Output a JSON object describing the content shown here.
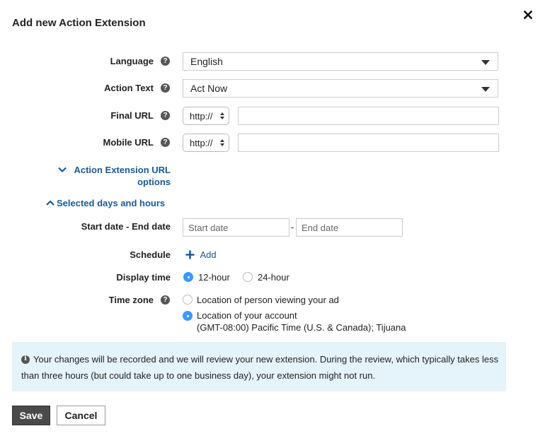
{
  "dialog": {
    "title": "Add new Action Extension",
    "close_icon": "close-icon"
  },
  "form": {
    "language": {
      "label": "Language",
      "value": "English",
      "help_icon": "question-circle-icon"
    },
    "action_text": {
      "label": "Action Text",
      "value": "Act Now",
      "help_icon": "question-circle-icon"
    },
    "final_url": {
      "label": "Final URL",
      "protocol": "http://",
      "value": "",
      "help_icon": "question-circle-icon"
    },
    "mobile_url": {
      "label": "Mobile URL",
      "protocol": "http://",
      "value": "",
      "help_icon": "question-circle-icon"
    },
    "url_options_toggle": {
      "label_line1": "Action Extension URL",
      "label_line2": "options",
      "icon": "chevron-down-icon"
    },
    "days_hours_toggle": {
      "label": "Selected days and hours",
      "icon": "chevron-up-icon"
    },
    "date_range": {
      "label": "Start date - End date",
      "start_placeholder": "Start date",
      "separator": "-",
      "end_placeholder": "End date"
    },
    "schedule": {
      "label": "Schedule",
      "add_label": "Add",
      "icon": "plus-icon"
    },
    "display_time": {
      "label": "Display time",
      "options": [
        {
          "label": "12-hour",
          "selected": true
        },
        {
          "label": "24-hour",
          "selected": false
        }
      ]
    },
    "time_zone": {
      "label": "Time zone",
      "help_icon": "question-circle-icon",
      "options": [
        {
          "label": "Location of person viewing your ad",
          "selected": false
        },
        {
          "label": "Location of your account",
          "sublabel": "(GMT-08:00) Pacific Time (U.S. & Canada); Tijuana",
          "selected": true
        }
      ]
    }
  },
  "notice": {
    "icon": "info-icon",
    "text": "Your changes will be recorded and we will review your new extension. During the review, which typically takes less than three hours (but could take up to one business day), your extension might not run."
  },
  "footer": {
    "save_label": "Save",
    "cancel_label": "Cancel"
  },
  "colors": {
    "link": "#1a5a96",
    "radio_selected": "#3b99fc",
    "notice_bg": "#e5f3fa",
    "save_bg": "#4a4a4a"
  }
}
